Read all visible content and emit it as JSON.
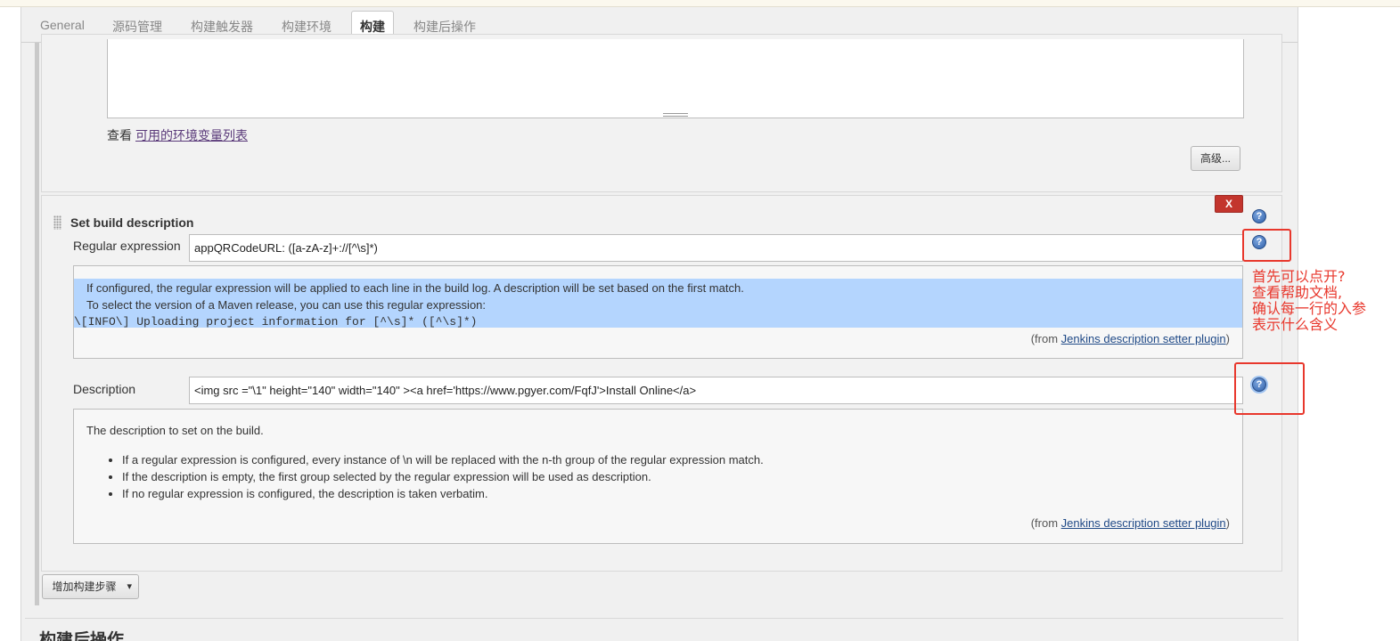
{
  "tabs": [
    {
      "label": "General"
    },
    {
      "label": "源码管理"
    },
    {
      "label": "构建触发器"
    },
    {
      "label": "构建环境"
    },
    {
      "label": "构建"
    },
    {
      "label": "构建后操作"
    }
  ],
  "env": {
    "prefix": "查看",
    "link": "可用的环境变量列表"
  },
  "advanced_button": "高级...",
  "step": {
    "title": "Set build description",
    "delete_label": "X",
    "help_glyph": "?",
    "regex": {
      "label": "Regular expression",
      "value": "appQRCodeURL: ([a-zA-z]+://[^\\s]*)",
      "help_lines": [
        "If configured, the regular expression will be applied to each line in the build log. A description will be set based on the first match.",
        "To select the version of a Maven release, you can use this regular expression:"
      ],
      "help_code": "\\[INFO\\] Uploading project information for [^\\s]* ([^\\s]*)",
      "from_prefix": "(from ",
      "from_link": "Jenkins description setter plugin",
      "from_suffix": ")"
    },
    "description": {
      "label": "Description",
      "value": "<img src =\"\\1\" height=\"140\" width=\"140\" ><a href='https://www.pgyer.com/FqfJ'>Install Online</a>",
      "help_intro": "The description to set on the build.",
      "help_bullets": [
        "If a regular expression is configured, every instance of \\n will be replaced with the n-th group of the regular expression match.",
        "If the description is empty, the first group selected by the regular expression will be used as description.",
        "If no regular expression is configured, the description is taken verbatim."
      ],
      "from_prefix": "(from ",
      "from_link": "Jenkins description setter plugin",
      "from_suffix": ")"
    }
  },
  "add_step_button": "增加构建步骤",
  "dropdown_glyph": "▾",
  "post_build_heading": "构建后操作",
  "annotation": {
    "lines": [
      "首先可以点开?",
      "查看帮助文档,",
      "确认每一行的入参",
      "表示什么含义"
    ],
    "color": "#e8372c"
  }
}
